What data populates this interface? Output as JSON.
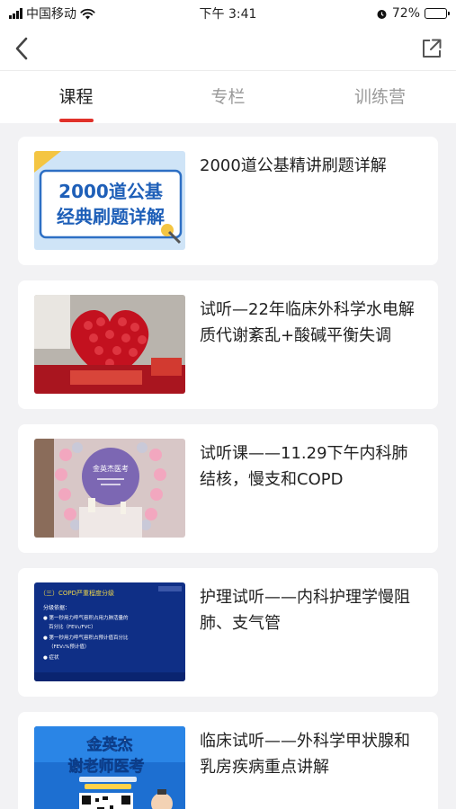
{
  "status_bar": {
    "carrier": "中国移动",
    "time": "下午 3:41",
    "battery_percent": "72%",
    "battery_level": 0.72
  },
  "nav": {
    "back_icon": "chevron-left-icon",
    "share_icon": "share-external-icon"
  },
  "tabs": [
    {
      "label": "课程",
      "active": true
    },
    {
      "label": "专栏",
      "active": false
    },
    {
      "label": "训练营",
      "active": false
    }
  ],
  "courses": [
    {
      "title": "2000道公基精讲刷题详解",
      "thumb_lines": [
        "2000道公基",
        "经典刷题详解"
      ]
    },
    {
      "title": "试听—22年临床外科学水电解质代谢紊乱+酸碱平衡失调"
    },
    {
      "title": "试听课——11.29下午内科肺结核，慢支和COPD",
      "thumb_text": "金英杰医考"
    },
    {
      "title": "护理试听——内科护理学慢阻肺、支气管",
      "thumb_heading": "（三）COPD严重程度分级",
      "thumb_lines": [
        "分级依据：",
        "● 第一秒用力呼气容积占用力肺活量的",
        "百分比（FEV₁/FVC）",
        "● 第一秒用力呼气容积占预计值百分比",
        "（FEV₁%预计值）",
        "● 症状"
      ]
    },
    {
      "title": "临床试听——外科学甲状腺和乳房疾病重点讲解",
      "thumb_lines": [
        "金英杰",
        "谢老师医考"
      ]
    }
  ]
}
